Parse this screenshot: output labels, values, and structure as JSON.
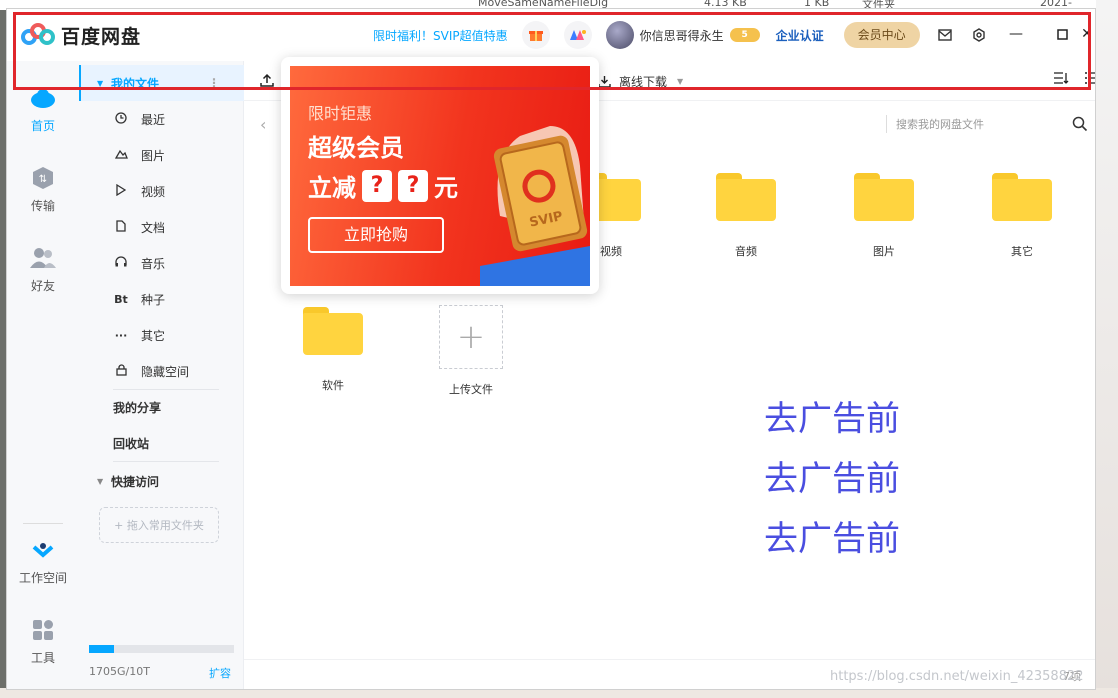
{
  "background": {
    "top_fragments": [
      "MoveSameNameFileDlg",
      "4.13 KB",
      "1 KB",
      "文件夹",
      "2021-"
    ]
  },
  "app": {
    "name": "百度网盘",
    "promo_link": "限时福利！SVIP超值特惠",
    "username": "你信思哥得永生",
    "svip_level": "5",
    "enterprise": "企业认证",
    "member_center": "会员中心"
  },
  "leftnav": {
    "items": [
      {
        "label": "首页",
        "icon": "cloud-icon",
        "active": true
      },
      {
        "label": "传输",
        "icon": "transfer-icon",
        "active": false
      },
      {
        "label": "好友",
        "icon": "friends-icon",
        "active": false
      },
      {
        "label": "工作空间",
        "icon": "workspace-icon",
        "active": false
      },
      {
        "label": "工具",
        "icon": "tools-icon",
        "active": false
      }
    ]
  },
  "sidebar": {
    "my_files": "我的文件",
    "items": [
      {
        "label": "最近",
        "icon": "clock-icon"
      },
      {
        "label": "图片",
        "icon": "image-icon"
      },
      {
        "label": "视频",
        "icon": "play-icon"
      },
      {
        "label": "文档",
        "icon": "document-icon"
      },
      {
        "label": "音乐",
        "icon": "headphones-icon"
      },
      {
        "label": "种子",
        "icon": "bt-icon"
      },
      {
        "label": "其它",
        "icon": "more-icon"
      },
      {
        "label": "隐藏空间",
        "icon": "lock-icon"
      }
    ],
    "my_share": "我的分享",
    "recycle": "回收站",
    "quick_access": "快捷访问",
    "drop_hint": "+ 拖入常用文件夹",
    "storage_text": "1705G/10T",
    "storage_fraction": 0.17,
    "expand": "扩容"
  },
  "toolbar": {
    "offline_download": "离线下载",
    "search_placeholder": "搜索我的网盘文件"
  },
  "files": [
    {
      "name": "视频"
    },
    {
      "name": "音频"
    },
    {
      "name": "图片"
    },
    {
      "name": "其它"
    },
    {
      "name": "软件"
    }
  ],
  "upload_label": "上传文件",
  "item_count": "7项",
  "annotation": [
    "去广告前",
    "去广告前",
    "去广告前"
  ],
  "watermark": "https://blog.csdn.net/weixin_42358822",
  "popup": {
    "line1": "限时钜惠",
    "line2": "超级会员",
    "line3_prefix": "立减",
    "line3_q": "?",
    "line3_suffix": "元",
    "cta": "立即抢购",
    "card_text": "SVIP"
  },
  "colors": {
    "accent": "#06a7ff",
    "annotation": "#4a4ee0",
    "highlight_box": "#e0262b"
  }
}
